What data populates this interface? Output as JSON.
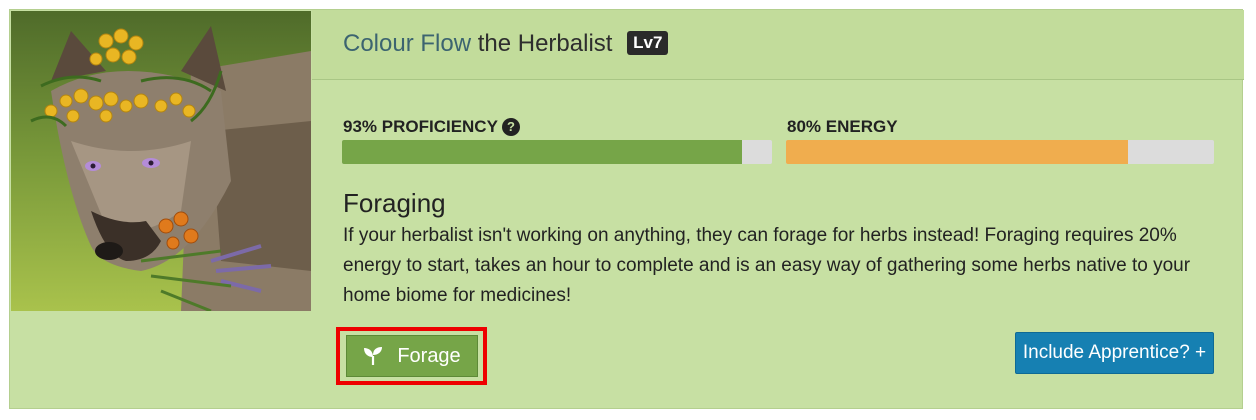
{
  "header": {
    "name": "Colour Flow",
    "title_suffix": "the Herbalist",
    "level": "Lv7"
  },
  "stats": {
    "proficiency_label": "93% PROFICIENCY",
    "proficiency_percent": 93,
    "energy_label": "80% ENERGY",
    "energy_percent": 80
  },
  "foraging": {
    "title": "Foraging",
    "description": "If your herbalist isn't working on anything, they can forage for herbs instead! Foraging requires 20% energy to start, takes an hour to complete and is an easy way of gathering some herbs native to your home biome for medicines!"
  },
  "buttons": {
    "forage_label": "Forage",
    "include_apprentice_label": "Include Apprentice? +"
  },
  "colors": {
    "card_bg": "#c7e0a3",
    "proficiency_fill": "#76a548",
    "energy_fill": "#f0ad4e",
    "bar_track": "#dcdcdc",
    "forage_button": "#76a548",
    "apprentice_button": "#1680b2",
    "highlight_outline": "#ee0000"
  },
  "icons": {
    "forage": "seedling-icon",
    "help": "question-circle-icon"
  }
}
